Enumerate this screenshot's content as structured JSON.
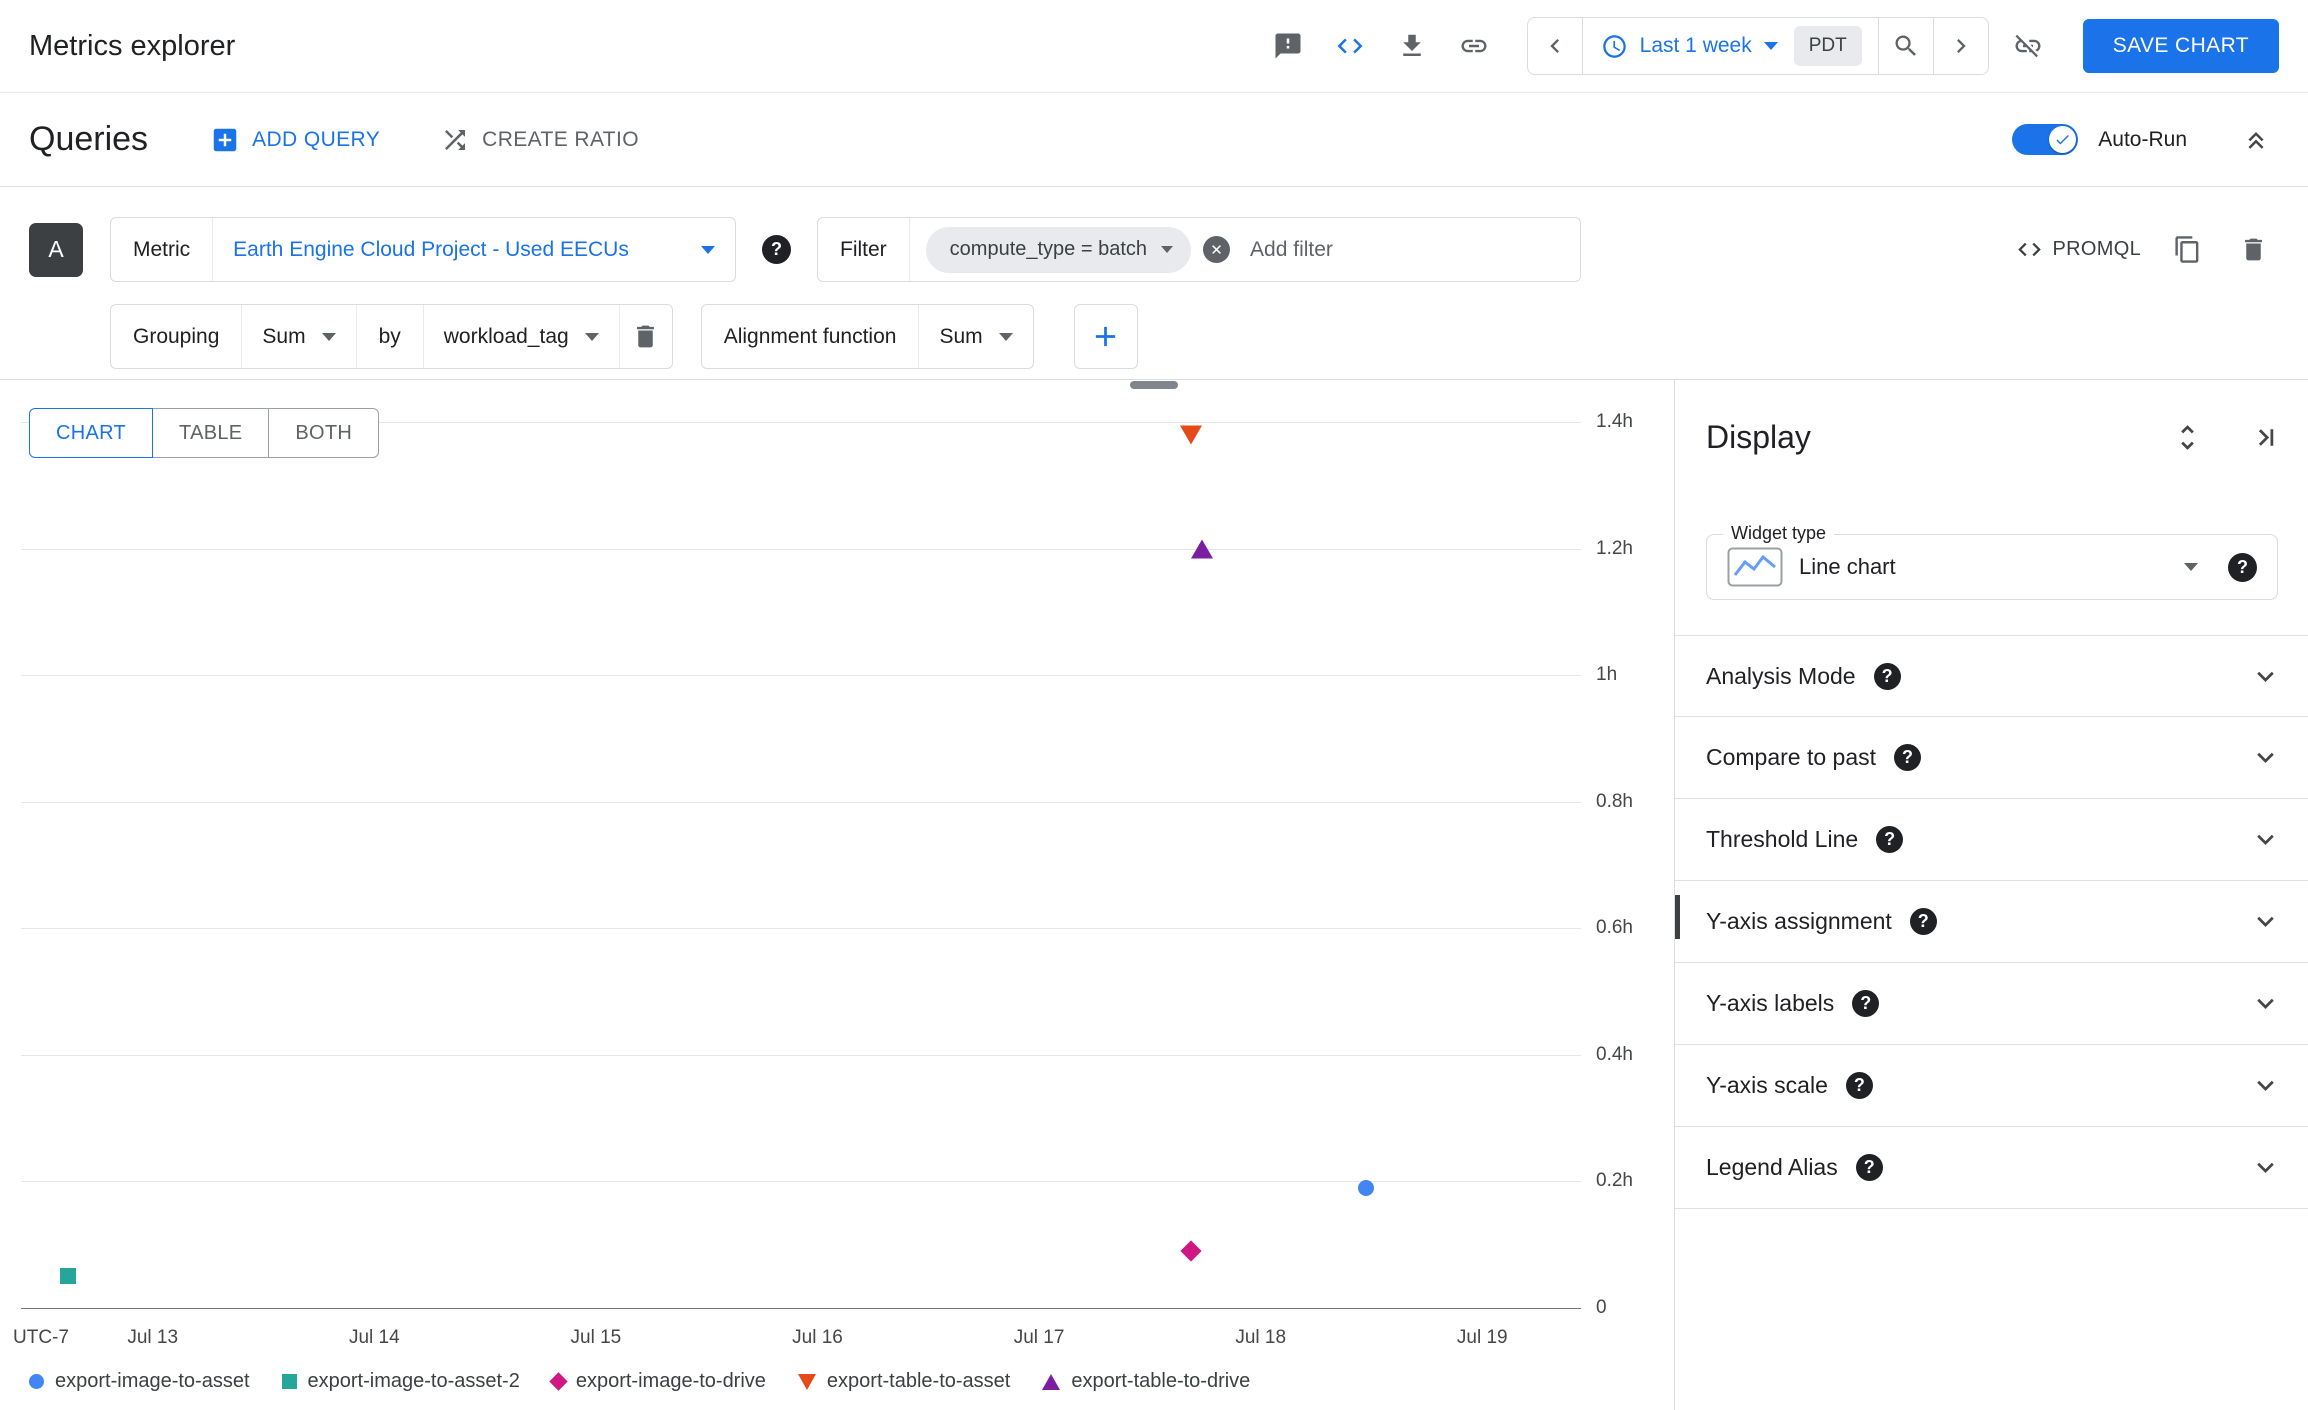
{
  "header": {
    "title": "Metrics explorer",
    "toolbar_icons": [
      "feedback-icon",
      "code-icon",
      "download-icon",
      "link-icon",
      "link-off-icon"
    ],
    "time_range": {
      "label": "Last 1 week",
      "timezone_badge": "PDT"
    },
    "save_button": "SAVE CHART"
  },
  "queries_bar": {
    "title": "Queries",
    "add_query": "ADD QUERY",
    "create_ratio": "CREATE RATIO",
    "auto_run_label": "Auto-Run",
    "auto_run_enabled": true
  },
  "query": {
    "badge": "A",
    "metric_label": "Metric",
    "metric_value": "Earth Engine Cloud Project - Used EECUs",
    "filter_label": "Filter",
    "filter_chip": "compute_type = batch",
    "add_filter_placeholder": "Add filter",
    "promql_label": "PROMQL",
    "grouping_label": "Grouping",
    "grouping_value": "Sum",
    "by_label": "by",
    "by_value": "workload_tag",
    "alignment_label": "Alignment function",
    "alignment_value": "Sum"
  },
  "view_tabs": [
    {
      "label": "CHART",
      "active": true
    },
    {
      "label": "TABLE",
      "active": false
    },
    {
      "label": "BOTH",
      "active": false
    }
  ],
  "chart_data": {
    "type": "scatter",
    "title": "",
    "grid": true,
    "legend_position": "bottom",
    "x_axis": {
      "timezone_label": "UTC-7",
      "domain_days": [
        12.52,
        19.56
      ],
      "ticks": [
        {
          "label": "Jul 13",
          "day": 13
        },
        {
          "label": "Jul 14",
          "day": 14
        },
        {
          "label": "Jul 15",
          "day": 15
        },
        {
          "label": "Jul 16",
          "day": 16
        },
        {
          "label": "Jul 17",
          "day": 17
        },
        {
          "label": "Jul 18",
          "day": 18
        },
        {
          "label": "Jul 19",
          "day": 19
        }
      ]
    },
    "y_axis": {
      "unit": "hours",
      "domain": [
        0,
        1.4
      ],
      "ticks": [
        {
          "label": "1.4h",
          "value": 1.4
        },
        {
          "label": "1.2h",
          "value": 1.2
        },
        {
          "label": "1h",
          "value": 1.0
        },
        {
          "label": "0.8h",
          "value": 0.8
        },
        {
          "label": "0.6h",
          "value": 0.6
        },
        {
          "label": "0.4h",
          "value": 0.4
        },
        {
          "label": "0.2h",
          "value": 0.2
        },
        {
          "label": "0",
          "value": 0
        }
      ]
    },
    "series": [
      {
        "name": "export-image-to-asset",
        "marker": "circle",
        "color": "#4285f4",
        "points": [
          {
            "x_day": 18.59,
            "y_hours": 0.19
          }
        ]
      },
      {
        "name": "export-image-to-asset-2",
        "marker": "square",
        "color": "#26a69a",
        "points": [
          {
            "x_day": 12.73,
            "y_hours": 0.05
          }
        ]
      },
      {
        "name": "export-image-to-drive",
        "marker": "diamond",
        "color": "#d01884",
        "points": [
          {
            "x_day": 17.8,
            "y_hours": 0.09
          }
        ]
      },
      {
        "name": "export-table-to-asset",
        "marker": "triangle-down",
        "color": "#e64a19",
        "points": [
          {
            "x_day": 17.8,
            "y_hours": 1.38
          }
        ]
      },
      {
        "name": "export-table-to-drive",
        "marker": "triangle-up",
        "color": "#7b1fa2",
        "points": [
          {
            "x_day": 17.85,
            "y_hours": 1.2
          }
        ]
      }
    ]
  },
  "display_panel": {
    "title": "Display",
    "widget_type_label": "Widget type",
    "widget_type_value": "Line chart",
    "sections": [
      {
        "label": "Analysis Mode"
      },
      {
        "label": "Compare to past"
      },
      {
        "label": "Threshold Line"
      },
      {
        "label": "Y-axis assignment"
      },
      {
        "label": "Y-axis labels"
      },
      {
        "label": "Y-axis scale"
      },
      {
        "label": "Legend Alias"
      }
    ]
  },
  "colors": {
    "accent": "#1a73e8",
    "text_primary": "#202124",
    "text_secondary": "#5f6368",
    "border": "#dadce0",
    "gridline": "#e6e6e6"
  }
}
